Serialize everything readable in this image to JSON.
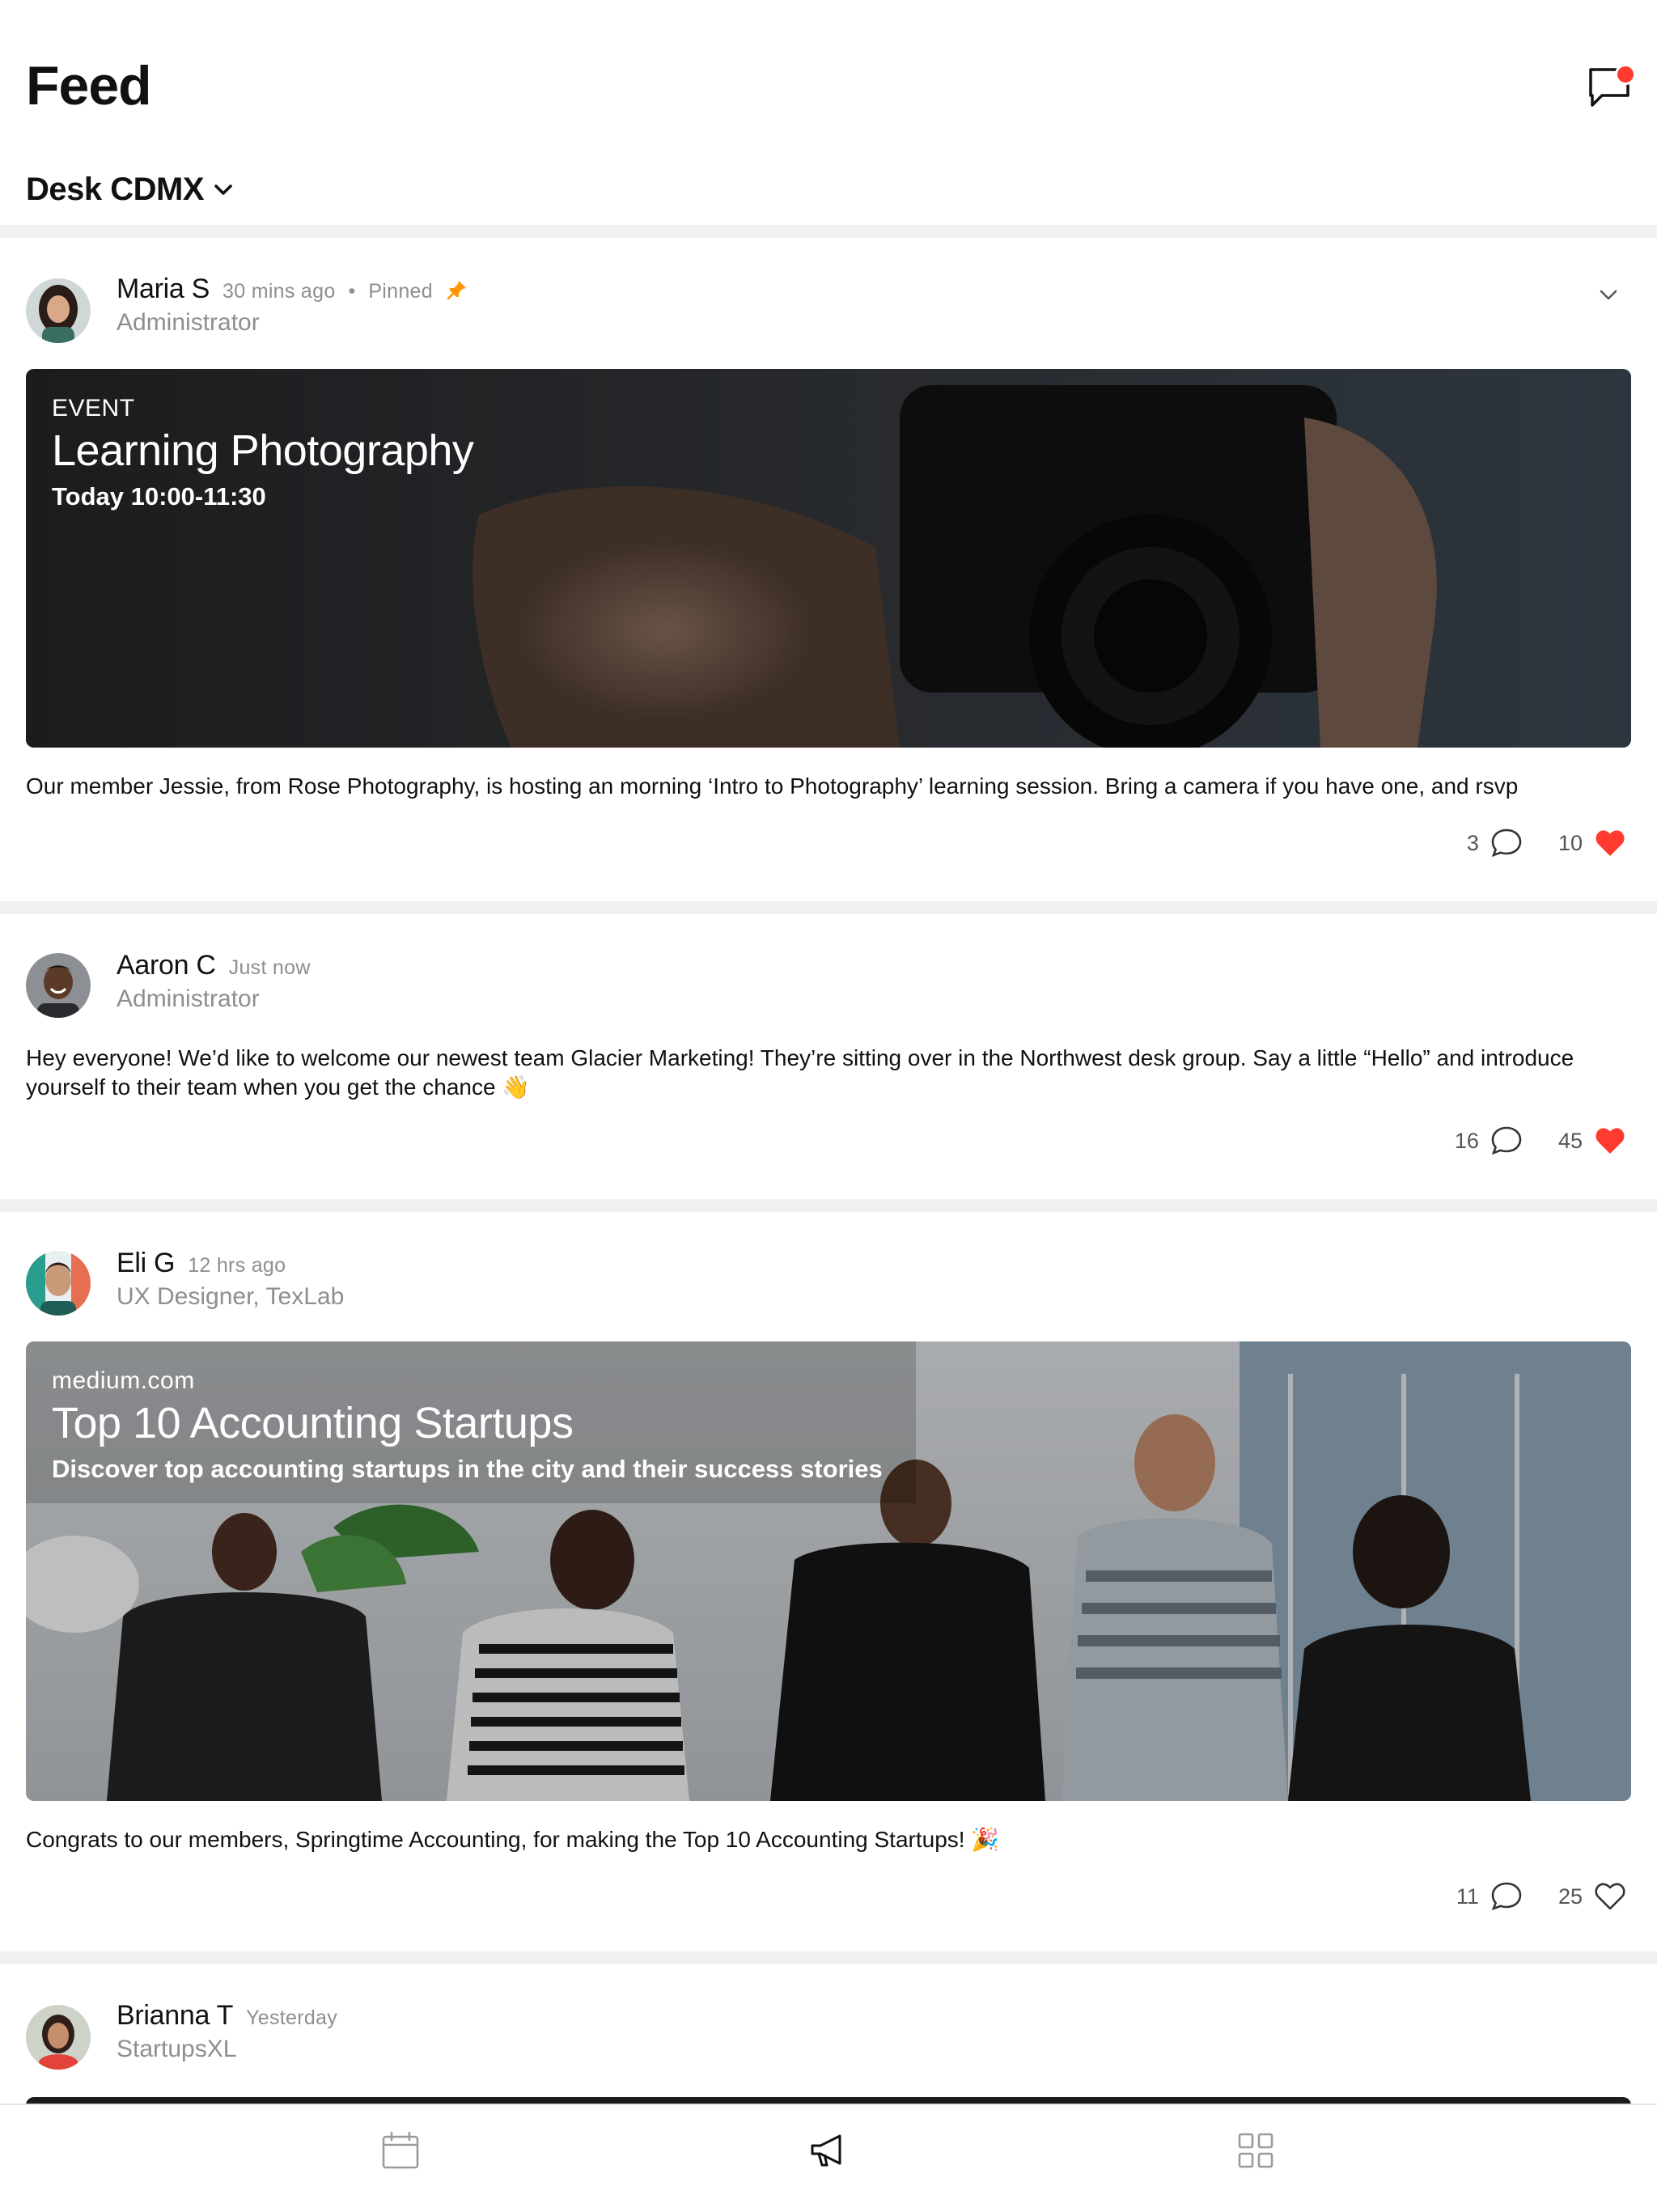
{
  "header": {
    "title": "Feed",
    "location": "Desk CDMX",
    "messages_icon": "chat-bubble-icon",
    "has_unread": true
  },
  "posts": [
    {
      "author": "Maria S",
      "time": "30 mins ago",
      "pinned_separator": "•",
      "pinned_label": "Pinned",
      "role": "Administrator",
      "media": {
        "kicker": "EVENT",
        "title": "Learning Photography",
        "subtitle": "Today 10:00-11:30"
      },
      "body": "Our member Jessie, from Rose Photography, is hosting an morning ‘Intro to Photography’ learning session. Bring a camera if you have one, and rsvp",
      "comments": "3",
      "likes": "10",
      "liked": true
    },
    {
      "author": "Aaron C",
      "time": "Just now",
      "role": "Administrator",
      "body": "Hey everyone! We’d like to welcome our newest team Glacier Marketing! They’re sitting over in the Northwest desk group. Say a little “Hello” and introduce yourself to their team when you get the chance 👋",
      "comments": "16",
      "likes": "45",
      "liked": true
    },
    {
      "author": "Eli G",
      "time": "12 hrs ago",
      "role": "UX Designer, TexLab",
      "media": {
        "kicker": "medium.com",
        "title": "Top 10 Accounting Startups",
        "subtitle": "Discover top accounting startups in the city and their success stories"
      },
      "body": "Congrats to our members, Springtime Accounting, for making the Top 10 Accounting Startups! 🎉",
      "comments": "11",
      "likes": "25",
      "liked": false
    },
    {
      "author": "Brianna T",
      "time": "Yesterday",
      "role": "StartupsXL"
    }
  ],
  "tabbar": {
    "items": [
      "calendar-icon",
      "megaphone-icon",
      "grid-icon"
    ],
    "active": "megaphone-icon"
  },
  "colors": {
    "accent_red": "#ff3b30",
    "pin_orange": "#ff9500",
    "muted_text": "#8e8e93",
    "divider": "#f1f1f2"
  }
}
